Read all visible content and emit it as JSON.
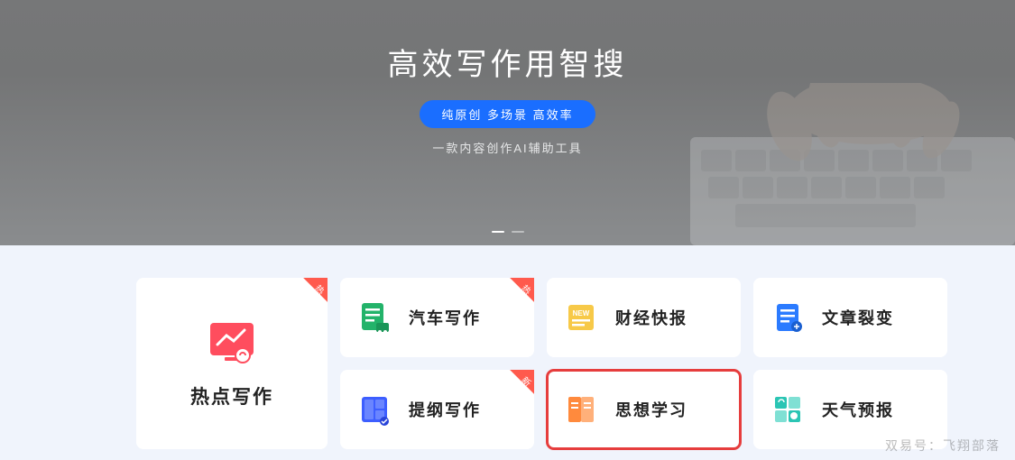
{
  "hero": {
    "title": "高效写作用智搜",
    "tagline": "纯原创 多场景 高效率",
    "subtitle": "一款内容创作AI辅助工具"
  },
  "badges": {
    "hot": "热",
    "new": "新"
  },
  "featureCard": {
    "title": "热点写作"
  },
  "cards": [
    {
      "label": "汽车写作",
      "badge": "hot"
    },
    {
      "label": "财经快报",
      "badge": null
    },
    {
      "label": "文章裂变",
      "badge": null
    },
    {
      "label": "提纲写作",
      "badge": "new"
    },
    {
      "label": "思想学习",
      "badge": null,
      "selected": true
    },
    {
      "label": "天气预报",
      "badge": null
    }
  ],
  "colors": {
    "accent": "#1a6eff",
    "hot": "#ff5a4d",
    "green": "#23b36a",
    "yellow": "#f7c948",
    "blue": "#2b7bff",
    "orange": "#ff8a3d",
    "teal": "#2bc5b4",
    "red": "#ff4d5e"
  },
  "watermark": "双易号：飞翔部落"
}
